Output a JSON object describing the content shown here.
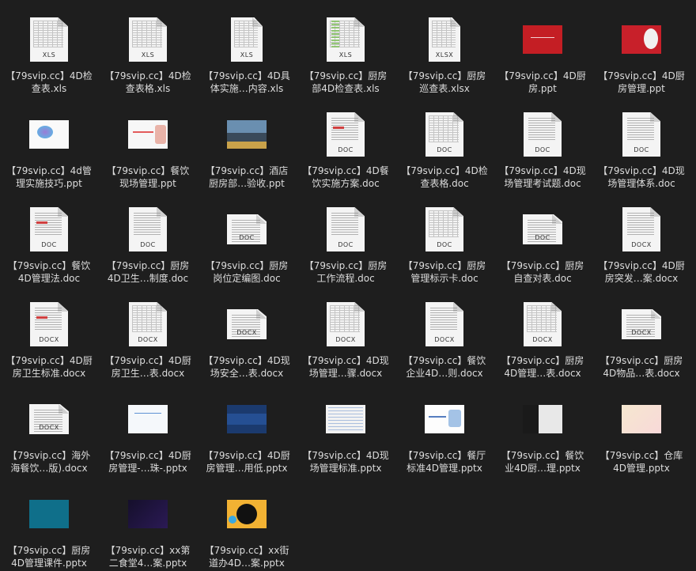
{
  "files": [
    {
      "line1": "【79svip.cc】4D检",
      "line2": "查表.xls",
      "kind": "sheet",
      "ext": "XLS"
    },
    {
      "line1": "【79svip.cc】4D检",
      "line2": "查表格.xls",
      "kind": "sheet",
      "ext": "XLS"
    },
    {
      "line1": "【79svip.cc】4D具",
      "line2": "体实施…内容.xls",
      "kind": "sheet-tall",
      "ext": "XLS"
    },
    {
      "line1": "【79svip.cc】厨房",
      "line2": "部4D检查表.xls",
      "kind": "sheet-green",
      "ext": "XLS"
    },
    {
      "line1": "【79svip.cc】厨房",
      "line2": "巡查表.xlsx",
      "kind": "sheet-tall",
      "ext": "XLSX"
    },
    {
      "line1": "【79svip.cc】4D厨",
      "line2": "房.ppt",
      "kind": "slide-red",
      "ext": ""
    },
    {
      "line1": "【79svip.cc】4D厨",
      "line2": "房管理.ppt",
      "kind": "slide-red2",
      "ext": ""
    },
    {
      "line1": "【79svip.cc】4d管",
      "line2": "理实施技巧.ppt",
      "kind": "slide-white-blob",
      "ext": ""
    },
    {
      "line1": "【79svip.cc】餐饮",
      "line2": "现场管理.ppt",
      "kind": "slide-white-red",
      "ext": ""
    },
    {
      "line1": "【79svip.cc】酒店",
      "line2": "厨房部…验收.ppt",
      "kind": "slide-photo",
      "ext": ""
    },
    {
      "line1": "【79svip.cc】4D餐",
      "line2": "饮实施方案.doc",
      "kind": "doc-red",
      "ext": "DOC"
    },
    {
      "line1": "【79svip.cc】4D检",
      "line2": "查表格.doc",
      "kind": "doc-grid",
      "ext": "DOC"
    },
    {
      "line1": "【79svip.cc】4D现",
      "line2": "场管理考试题.doc",
      "kind": "doc",
      "ext": "DOC"
    },
    {
      "line1": "【79svip.cc】4D现",
      "line2": "场管理体系.doc",
      "kind": "doc",
      "ext": "DOC"
    },
    {
      "line1": "【79svip.cc】餐饮",
      "line2": "4D管理法.doc",
      "kind": "doc-red",
      "ext": "DOC"
    },
    {
      "line1": "【79svip.cc】厨房",
      "line2": "4D卫生…制度.doc",
      "kind": "doc",
      "ext": "DOC"
    },
    {
      "line1": "【79svip.cc】厨房",
      "line2": "岗位定编图.doc",
      "kind": "doc-land",
      "ext": "DOC"
    },
    {
      "line1": "【79svip.cc】厨房",
      "line2": "工作流程.doc",
      "kind": "doc",
      "ext": "DOC"
    },
    {
      "line1": "【79svip.cc】厨房",
      "line2": "管理标示卡.doc",
      "kind": "doc-grid",
      "ext": "DOC"
    },
    {
      "line1": "【79svip.cc】厨房",
      "line2": "自查对表.doc",
      "kind": "doc-land",
      "ext": "DOC"
    },
    {
      "line1": "【79svip.cc】4D厨",
      "line2": "房突发…案.docx",
      "kind": "doc",
      "ext": "DOCX"
    },
    {
      "line1": "【79svip.cc】4D厨",
      "line2": "房卫生标准.docx",
      "kind": "doc-red",
      "ext": "DOCX"
    },
    {
      "line1": "【79svip.cc】4D厨",
      "line2": "房卫生…表.docx",
      "kind": "doc-grid",
      "ext": "DOCX"
    },
    {
      "line1": "【79svip.cc】4D现",
      "line2": "场安全…表.docx",
      "kind": "doc-land",
      "ext": "DOCX"
    },
    {
      "line1": "【79svip.cc】4D现",
      "line2": "场管理…骤.docx",
      "kind": "doc-grid",
      "ext": "DOCX"
    },
    {
      "line1": "【79svip.cc】餐饮",
      "line2": "企业4D…则.docx",
      "kind": "doc",
      "ext": "DOCX"
    },
    {
      "line1": "【79svip.cc】厨房",
      "line2": "4D管理…表.docx",
      "kind": "doc-grid",
      "ext": "DOCX"
    },
    {
      "line1": "【79svip.cc】厨房",
      "line2": "4D物品…表.docx",
      "kind": "doc-land",
      "ext": "DOCX"
    },
    {
      "line1": "【79svip.cc】海外",
      "line2": "海餐饮…版).docx",
      "kind": "doc-land",
      "ext": "DOCX"
    },
    {
      "line1": "【79svip.cc】4D厨",
      "line2": "房管理-…珠-.pptx",
      "kind": "slide-white-lines",
      "ext": ""
    },
    {
      "line1": "【79svip.cc】4D厨",
      "line2": "房管理…用低.pptx",
      "kind": "slide-navy",
      "ext": ""
    },
    {
      "line1": "【79svip.cc】4D现",
      "line2": "场管理标准.pptx",
      "kind": "slide-table",
      "ext": ""
    },
    {
      "line1": "【79svip.cc】餐厅",
      "line2": "标准4D管理.pptx",
      "kind": "slide-white-blue",
      "ext": ""
    },
    {
      "line1": "【79svip.cc】餐饮",
      "line2": "业4D厨…理.pptx",
      "kind": "slide-dark-photo",
      "ext": ""
    },
    {
      "line1": "【79svip.cc】仓库",
      "line2": "4D管理.pptx",
      "kind": "slide-pastel",
      "ext": ""
    },
    {
      "line1": "【79svip.cc】厨房",
      "line2": "4D管理课件.pptx",
      "kind": "slide-teal",
      "ext": ""
    },
    {
      "line1": "【79svip.cc】xx第",
      "line2": "二食堂4…案.pptx",
      "kind": "slide-purple",
      "ext": ""
    },
    {
      "line1": "【79svip.cc】xx街",
      "line2": "道办4D…案.pptx",
      "kind": "slide-colorful",
      "ext": ""
    }
  ]
}
